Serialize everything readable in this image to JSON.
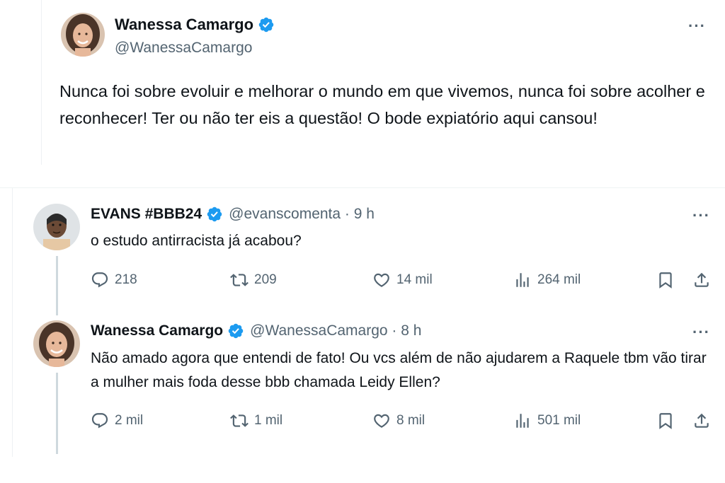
{
  "main_tweet": {
    "author_name": "Wanessa Camargo",
    "author_handle": "@WanessaCamargo",
    "text": "Nunca foi sobre evoluir e melhorar o mundo em que vivemos, nunca foi sobre acolher e reconhecer! Ter ou não ter eis a questão! O bode expiatório aqui cansou!",
    "more_label": "···"
  },
  "replies": [
    {
      "author_name": "EVANS #BBB24",
      "author_handle": "@evanscomenta · 9 h",
      "text": "o estudo antirracista já acabou?",
      "more_label": "···",
      "replies_count": "218",
      "retweets_count": "209",
      "likes_count": "14 mil",
      "views_count": "264 mil"
    },
    {
      "author_name": "Wanessa Camargo",
      "author_handle": "@WanessaCamargo · 8 h",
      "text": "Não amado agora que entendi de fato! Ou vcs além de não ajudarem a Raquele tbm vão tirar a mulher mais foda desse bbb chamada Leidy Ellen?",
      "more_label": "···",
      "replies_count": "2 mil",
      "retweets_count": "1 mil",
      "likes_count": "8 mil",
      "views_count": "501 mil"
    }
  ],
  "colors": {
    "verified": "#1d9bf0",
    "secondary_text": "#536471",
    "primary_text": "#0f1419",
    "thread_line": "#cfd9de"
  },
  "icons": [
    "verified-badge-icon",
    "more-icon",
    "reply-icon",
    "retweet-icon",
    "like-icon",
    "views-icon",
    "bookmark-icon",
    "share-icon"
  ]
}
